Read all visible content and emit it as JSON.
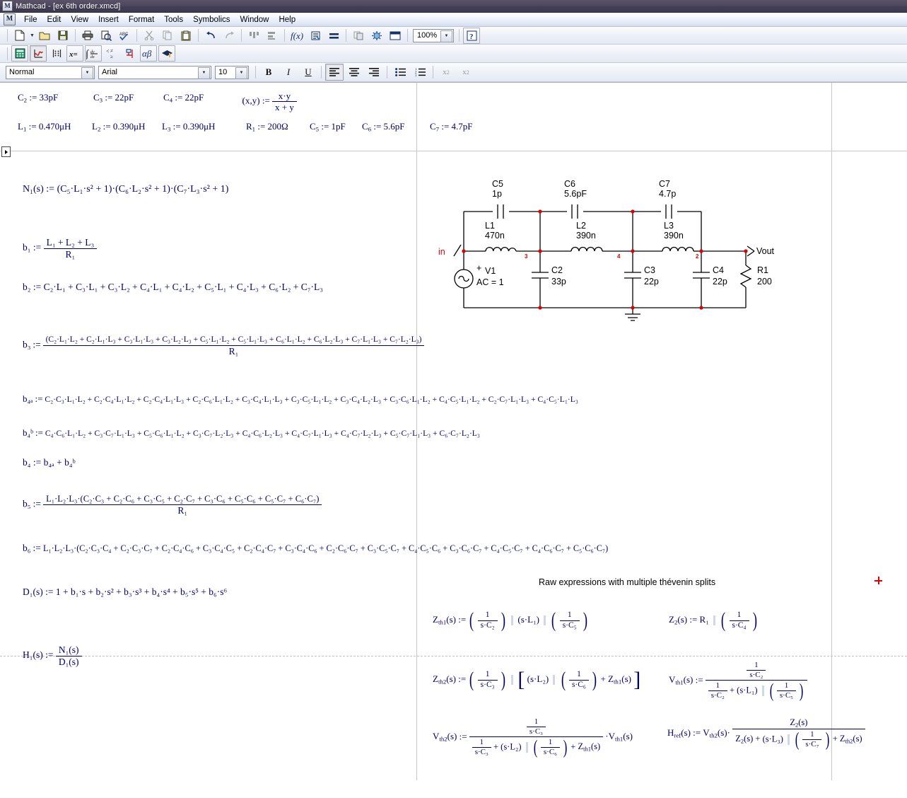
{
  "window": {
    "title": "Mathcad - [ex 6th order.xmcd]",
    "app_icon": "M"
  },
  "menu": {
    "app_icon": "M",
    "items": [
      {
        "label": "File"
      },
      {
        "label": "Edit"
      },
      {
        "label": "View"
      },
      {
        "label": "Insert"
      },
      {
        "label": "Format"
      },
      {
        "label": "Tools"
      },
      {
        "label": "Symbolics"
      },
      {
        "label": "Window"
      },
      {
        "label": "Help"
      }
    ]
  },
  "standard_toolbar": {
    "zoom_value": "100%",
    "buttons": [
      {
        "name": "new-document-button",
        "glyph": "⬜"
      },
      {
        "name": "new-document-dropdown",
        "glyph": "▾"
      },
      {
        "name": "open-button",
        "glyph": "📂"
      },
      {
        "name": "save-button",
        "glyph": "💾"
      },
      {
        "name": "print-button",
        "glyph": "🖨"
      },
      {
        "name": "print-preview-button",
        "glyph": "🔍"
      },
      {
        "name": "spell-check-button",
        "glyph": "ABC"
      },
      {
        "name": "cut-button",
        "glyph": "✂"
      },
      {
        "name": "copy-button",
        "glyph": "⧉"
      },
      {
        "name": "paste-button",
        "glyph": "📋"
      },
      {
        "name": "undo-button",
        "glyph": "↶"
      },
      {
        "name": "redo-button",
        "glyph": "↷"
      },
      {
        "name": "align-across-button",
        "glyph": "⦇"
      },
      {
        "name": "align-down-button",
        "glyph": "⌶"
      },
      {
        "name": "insert-function-button",
        "glyph": "f(x)"
      },
      {
        "name": "insert-unit-button",
        "glyph": "⚗"
      },
      {
        "name": "calculate-button",
        "glyph": "="
      },
      {
        "name": "insert-hyperlink-button",
        "glyph": "⌘"
      },
      {
        "name": "insert-component-button",
        "glyph": "⚙"
      },
      {
        "name": "insert-area-button",
        "glyph": "▣"
      },
      {
        "name": "help-button",
        "glyph": "?"
      }
    ]
  },
  "math_toolbar": {
    "buttons": [
      {
        "name": "calculator-palette-button",
        "glyph": "▦"
      },
      {
        "name": "graph-palette-button",
        "glyph": "↗"
      },
      {
        "name": "matrix-palette-button",
        "glyph": "∷"
      },
      {
        "name": "evaluation-palette-button",
        "glyph": "x="
      },
      {
        "name": "calculus-palette-button",
        "glyph": "∫"
      },
      {
        "name": "boolean-palette-button",
        "glyph": "<≤"
      },
      {
        "name": "programming-palette-button",
        "glyph": "⎇"
      },
      {
        "name": "greek-palette-button",
        "glyph": "αβ"
      },
      {
        "name": "symbolic-palette-button",
        "glyph": "⬟"
      }
    ]
  },
  "format_toolbar": {
    "style": "Normal",
    "font": "Arial",
    "size": "10",
    "bold": "B",
    "italic": "I",
    "underline": "U",
    "align_left": "≡",
    "align_center": "≡",
    "align_right": "≡",
    "bullet_list": "☰",
    "numbered_list": "☰",
    "superscript": "x²",
    "subscript": "x₂"
  },
  "worksheet": {
    "definitions_row1": [
      {
        "id": "C2",
        "name": "C",
        "sub": "2",
        "value": "33pF"
      },
      {
        "id": "C3",
        "name": "C",
        "sub": "3",
        "value": "22pF"
      },
      {
        "id": "C4",
        "name": "C",
        "sub": "4",
        "value": "22pF"
      }
    ],
    "parallel_operator": {
      "lhs": "(x,y)",
      "num": "x·y",
      "den": "x + y"
    },
    "definitions_row2": [
      {
        "id": "L1",
        "name": "L",
        "sub": "1",
        "value": "0.470μH"
      },
      {
        "id": "L2",
        "name": "L",
        "sub": "2",
        "value": "0.390μH"
      },
      {
        "id": "L3",
        "name": "L",
        "sub": "3",
        "value": "0.390μH"
      },
      {
        "id": "R1",
        "name": "R",
        "sub": "1",
        "value": "200Ω"
      },
      {
        "id": "C5",
        "name": "C",
        "sub": "5",
        "value": "1pF"
      },
      {
        "id": "C6",
        "name": "C",
        "sub": "6",
        "value": "5.6pF"
      },
      {
        "id": "C7",
        "name": "C",
        "sub": "7",
        "value": "4.7pF"
      }
    ],
    "N1": {
      "lhs": "N₁(s)",
      "rhs": "(C₅·L₁·s² + 1)·(C₆·L₂·s² + 1)·(C₇·L₃·s² + 1)"
    },
    "b1": {
      "lhs": "b₁",
      "num": "L₁ + L₂ + L₃",
      "den": "R₁"
    },
    "b2": {
      "lhs": "b₂",
      "rhs": "C₂·L₁ + C₃·L₁ + C₃·L₂ + C₄·L₁ + C₄·L₂ + C₅·L₁ + C₄·L₃ + C₆·L₂ + C₇·L₃"
    },
    "b3": {
      "lhs": "b₃",
      "num": "(C₂·L₁·L₂ + C₂·L₁·L₃ + C₃·L₁·L₃ + C₃·L₂·L₃ + C₅·L₁·L₂ + C₅·L₁·L₃ + C₆·L₁·L₂ + C₆·L₂·L₃ + C₇·L₁·L₃ + C₇·L₂·L₃)",
      "den": "R₁"
    },
    "b4a": {
      "lhs": "b₄ₐ",
      "rhs": "C₂·C₃·L₁·L₂ + C₂·C₄·L₁·L₂ + C₂·C₄·L₁·L₃ + C₂·C₆·L₁·L₂ + C₃·C₄·L₁·L₃ + C₃·C₅·L₁·L₂ + C₃·C₄·L₂·L₃ + C₃·C₆·L₁·L₂ + C₄·C₅·L₁·L₂ + C₂·C₇·L₁·L₃ + C₄·C₅·L₁·L₃"
    },
    "b4b": {
      "lhs": "b₄ᵇ",
      "rhs": "C₄·C₆·L₁·L₂ + C₃·C₇·L₁·L₃ + C₅·C₆·L₁·L₂ + C₃·C₇·L₂·L₃ + C₄·C₆·L₂·L₃ + C₄·C₇·L₁·L₃ + C₄·C₇·L₂·L₃ + C₅·C₇·L₁·L₃ + C₆·C₇·L₂·L₃"
    },
    "b4": {
      "lhs": "b₄",
      "rhs": "b₄ₐ + b₄ᵇ"
    },
    "b5": {
      "lhs": "b₅",
      "num": "L₁·L₂·L₃·(C₂·C₃ + C₂·C₆ + C₃·C₅ + C₂·C₇ + C₃·C₆ + C₅·C₆ + C₅·C₇ + C₆·C₇)",
      "den": "R₁"
    },
    "b6": {
      "lhs": "b₆",
      "rhs": "L₁·L₂·L₃·(C₂·C₃·C₄ + C₂·C₃·C₇ + C₂·C₄·C₆ + C₃·C₄·C₅ + C₂·C₄·C₇ + C₃·C₄·C₆ + C₂·C₆·C₇ + C₃·C₅·C₇ + C₄·C₅·C₆ + C₃·C₆·C₇ + C₄·C₅·C₇ + C₄·C₆·C₇ + C₅·C₆·C₇)"
    },
    "D1": {
      "lhs": "D₁(s)",
      "rhs": "1 + b₁·s + b₂·s² + b₃·s³ + b₄·s⁴ + b₅·s⁵ + b₆·s⁶"
    },
    "H1": {
      "lhs": "H₁(s)",
      "num": "N₁(s)",
      "den": "D₁(s)"
    },
    "thevenin_heading": "Raw expressions with multiple thévenin splits",
    "Zth1": {
      "lhs": "Z",
      "lhs_sub": "th1",
      "lhs_arg": "(s)",
      "t1_num": "1",
      "t1_den": "s·C₂",
      "t2": "(s·L₁)",
      "t3_num": "1",
      "t3_den": "s·C₅"
    },
    "Z2": {
      "lhs": "Z",
      "lhs_sub": "2",
      "lhs_arg": "(s)",
      "t1": "R₁",
      "t2_num": "1",
      "t2_den": "s·C₄"
    },
    "Zth2": {
      "lhs": "Z",
      "lhs_sub": "th2",
      "lhs_arg": "(s)",
      "t1_num": "1",
      "t1_den": "s·C₃",
      "t2": "(s·L₂)",
      "t3_num": "1",
      "t3_den": "s·C₆",
      "t4": "Z",
      "t4_sub": "th1",
      "t4_arg": "(s)"
    },
    "Vth1": {
      "lhs": "V",
      "lhs_sub": "th1",
      "lhs_arg": "(s)",
      "num_num": "1",
      "num_den": "s·C₂",
      "den_a_num": "1",
      "den_a_den": "s·C₂",
      "den_b": "(s·L₁)",
      "den_c_num": "1",
      "den_c_den": "s·C₅"
    },
    "Vth2": {
      "lhs": "V",
      "lhs_sub": "th2",
      "lhs_arg": "(s)",
      "num_num": "1",
      "num_den": "s·C₃",
      "den_a_num": "1",
      "den_a_den": "s·C₃",
      "den_b": "(s·L₂)",
      "den_c_num": "1",
      "den_c_den": "s·C₆",
      "den_d": "Z",
      "den_d_sub": "th1",
      "den_d_arg": "(s)",
      "mult": "·V",
      "mult_sub": "th1",
      "mult_arg": "(s)"
    },
    "Href": {
      "lhs": "H",
      "lhs_sub": "ref",
      "lhs_arg": "(s)",
      "factor": "V",
      "factor_sub": "th2",
      "factor_arg": "(s)·",
      "num": "Z",
      "num_sub": "2",
      "num_arg": "(s)",
      "den_a": "Z",
      "den_a_sub": "2",
      "den_a_arg": "(s) + ",
      "den_b": "(s·L₃)",
      "den_c_num": "1",
      "den_c_den": "s·C₇",
      "den_d": " + Z",
      "den_d_sub": "th2",
      "den_d_arg": "(s)"
    },
    "assign_op": ":=",
    "parallel_glyph": "‖"
  },
  "circuit": {
    "input_label": "in",
    "output_label": "Vout",
    "source": {
      "ref": "V1",
      "value": "AC = 1",
      "plus": "+"
    },
    "nodes": [
      {
        "label": "3"
      },
      {
        "label": "4"
      },
      {
        "label": "2"
      }
    ],
    "series_caps": [
      {
        "ref": "C5",
        "value": "1p"
      },
      {
        "ref": "C6",
        "value": "5.6pF"
      },
      {
        "ref": "C7",
        "value": "4.7p"
      }
    ],
    "inductors": [
      {
        "ref": "L1",
        "value": "470n"
      },
      {
        "ref": "L2",
        "value": "390n"
      },
      {
        "ref": "L3",
        "value": "390n"
      }
    ],
    "shunt_caps": [
      {
        "ref": "C2",
        "value": "33p"
      },
      {
        "ref": "C3",
        "value": "22p"
      },
      {
        "ref": "C4",
        "value": "22p"
      }
    ],
    "resistor": {
      "ref": "R1",
      "value": "200"
    }
  },
  "colors": {
    "math_text": "#00006b",
    "circuit_accent": "#e00000",
    "titlebar": "#4a4460",
    "rule": "#c8c8c8"
  }
}
